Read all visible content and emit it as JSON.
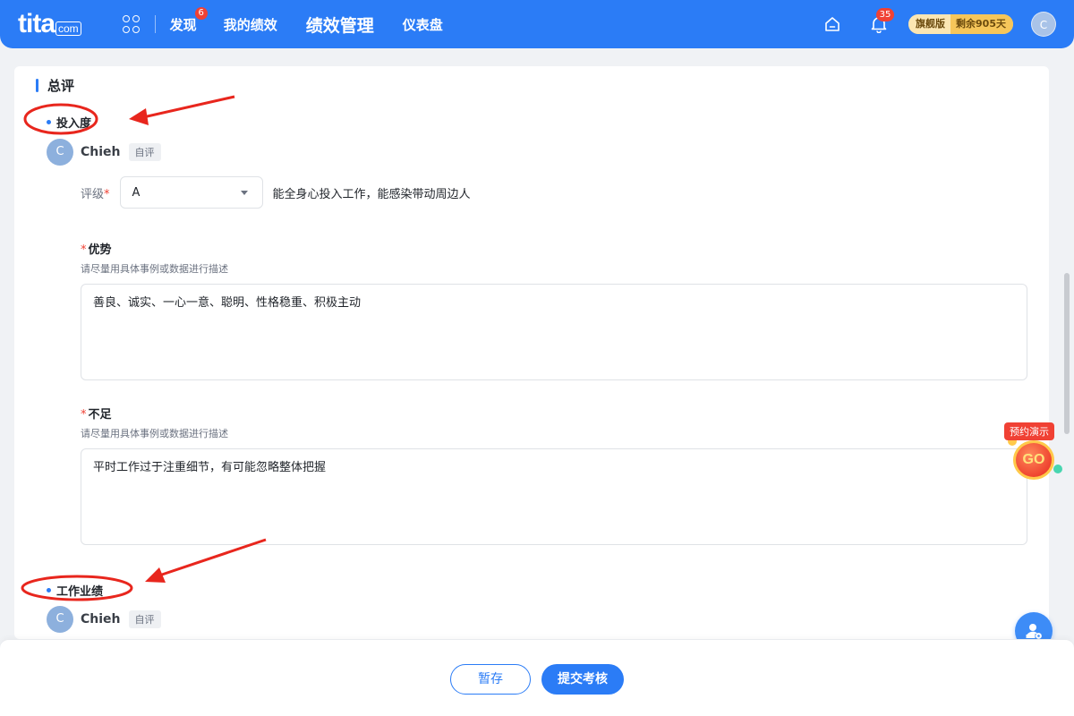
{
  "header": {
    "logo_main": "tita",
    "logo_suffix": "com",
    "nav": [
      {
        "label": "发现",
        "badge": "6"
      },
      {
        "label": "我的绩效"
      },
      {
        "label": "绩效管理",
        "active": true
      },
      {
        "label": "仪表盘"
      }
    ],
    "notification_count": "35",
    "plan_name": "旗舰版",
    "plan_remaining": "剩余905天",
    "user_initial": "C"
  },
  "section": {
    "title": "总评",
    "engagement": {
      "title": "投入度",
      "user_initial": "C",
      "user_name": "Chieh",
      "user_tag": "自评",
      "rating_label": "评级",
      "rating_required": "*",
      "rating_value": "A",
      "rating_description": "能全身心投入工作，能感染带动周边人",
      "strengths_label": "优势",
      "strengths_hint": "请尽量用具体事例或数据进行描述",
      "strengths_value": "善良、诚实、一心一意、聪明、性格稳重、积极主动",
      "weaknesses_label": "不足",
      "weaknesses_hint": "请尽量用具体事例或数据进行描述",
      "weaknesses_value": "平时工作过于注重细节，有可能忽略整体把握",
      "required_mark": "*"
    },
    "performance": {
      "title": "工作业绩",
      "user_initial": "C",
      "user_name": "Chieh",
      "user_tag": "自评"
    }
  },
  "demo": {
    "tag": "预约演示",
    "go": "GO"
  },
  "actions": {
    "save_label": "暂存",
    "submit_label": "提交考核"
  },
  "colors": {
    "primary": "#2b7cf6",
    "danger": "#f04134",
    "annotation": "#e8261d"
  }
}
